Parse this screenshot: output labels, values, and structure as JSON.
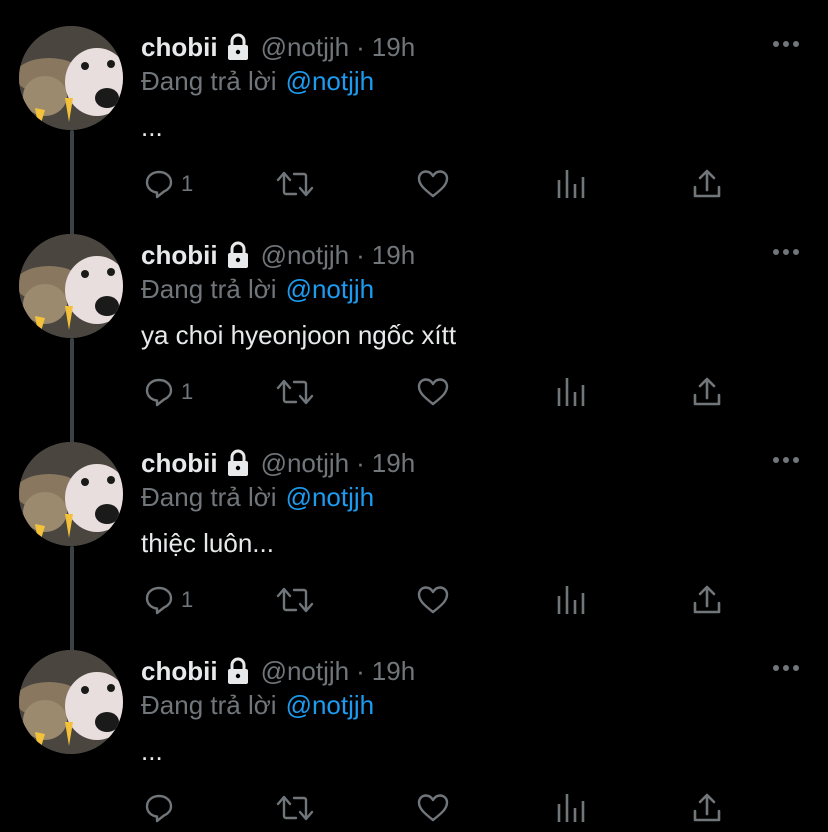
{
  "colors": {
    "background": "#000000",
    "primary_text": "#e7e9ea",
    "secondary_text": "#71767b",
    "link": "#1d9bf0",
    "thread_line": "#3c4146"
  },
  "icons": {
    "more": "more-horizontal-icon",
    "lock": "lock-icon",
    "reply": "reply-icon",
    "retweet": "retweet-icon",
    "like": "heart-icon",
    "analytics": "analytics-icon",
    "share": "share-icon"
  },
  "tweets": [
    {
      "display_name": "chobii",
      "handle": "@notjjh",
      "separator": "·",
      "time": "19h",
      "reply_prefix": "Đang trả lời",
      "reply_to": "@notjjh",
      "text": "...",
      "reply_count": "1"
    },
    {
      "display_name": "chobii",
      "handle": "@notjjh",
      "separator": "·",
      "time": "19h",
      "reply_prefix": "Đang trả lời",
      "reply_to": "@notjjh",
      "text": "ya choi hyeonjoon ngốc xítt",
      "reply_count": "1"
    },
    {
      "display_name": "chobii",
      "handle": "@notjjh",
      "separator": "·",
      "time": "19h",
      "reply_prefix": "Đang trả lời",
      "reply_to": "@notjjh",
      "text": "thiệc luôn...",
      "reply_count": "1"
    },
    {
      "display_name": "chobii",
      "handle": "@notjjh",
      "separator": "·",
      "time": "19h",
      "reply_prefix": "Đang trả lời",
      "reply_to": "@notjjh",
      "text": "...",
      "reply_count": ""
    }
  ]
}
